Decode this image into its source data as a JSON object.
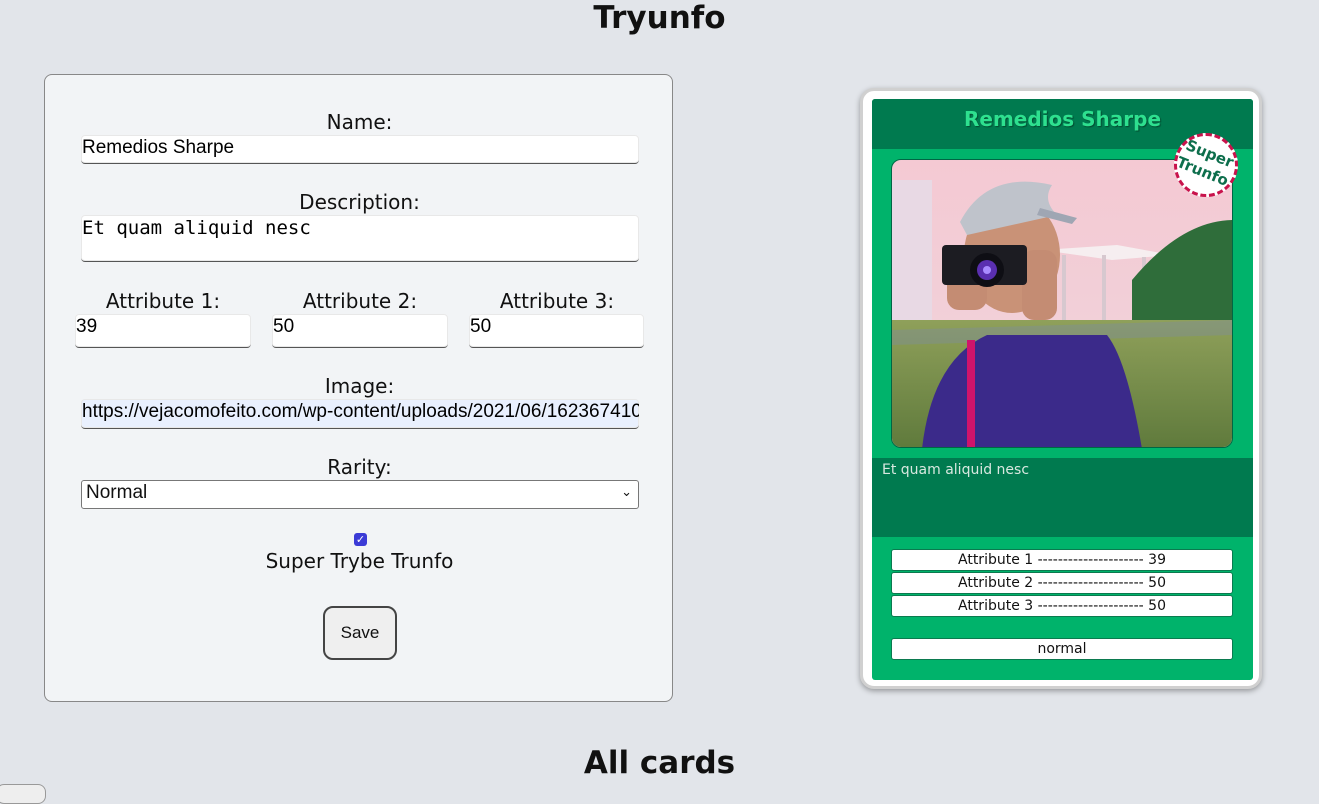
{
  "header": {
    "title": "Tryunfo"
  },
  "form": {
    "name_label": "Name:",
    "name_value": "Remedios Sharpe",
    "description_label": "Description:",
    "description_value": "Et quam aliquid nesc",
    "attr1_label": "Attribute 1:",
    "attr1_value": "39",
    "attr2_label": "Attribute 2:",
    "attr2_value": "50",
    "attr3_label": "Attribute 3:",
    "attr3_value": "50",
    "image_label": "Image:",
    "image_value": "https://vejacomofeito.com/wp-content/uploads/2021/06/162367410",
    "rarity_label": "Rarity:",
    "rarity_value": "Normal",
    "trunfo_checked": true,
    "trunfo_label": "Super Trybe Trunfo",
    "save_label": "Save"
  },
  "card": {
    "name": "Remedios Sharpe",
    "seal_text_1": "Super",
    "seal_text_2": "Trunfo",
    "description": "Et quam aliquid nesc",
    "attr1": "Attribute 1 --------------------- 39",
    "attr2": "Attribute 2 --------------------- 50",
    "attr3": "Attribute 3 --------------------- 50",
    "rarity": "normal",
    "colors": {
      "name_bar": "#007a4f",
      "body": "#00b36b",
      "name_text": "#2ee08f",
      "seal_border": "#c8134c"
    }
  },
  "all_cards": {
    "title": "All cards"
  }
}
